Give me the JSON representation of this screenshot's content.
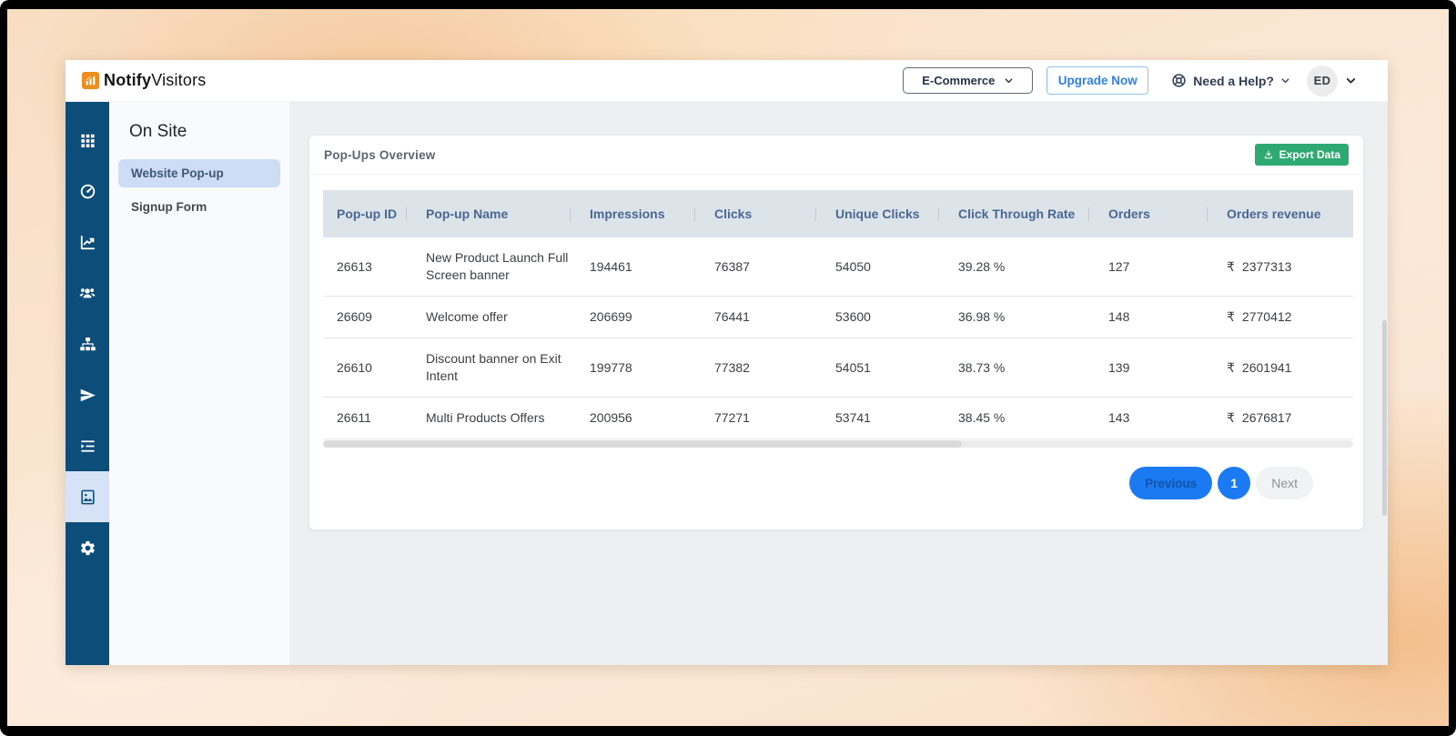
{
  "brand": {
    "name_bold": "Notify",
    "name_light": "Visitors",
    "logo_color": "#ef8e1e"
  },
  "topbar": {
    "workspace_selected": "E-Commerce",
    "upgrade_label": "Upgrade Now",
    "help_label": "Need a Help?",
    "avatar_initials": "ED"
  },
  "rail": {
    "items": [
      {
        "icon": "apps-grid-icon",
        "active": false
      },
      {
        "icon": "dashboard-gauge-icon",
        "active": false
      },
      {
        "icon": "analytics-line-chart-icon",
        "active": false
      },
      {
        "icon": "users-icon",
        "active": false
      },
      {
        "icon": "sitemap-icon",
        "active": false
      },
      {
        "icon": "send-plane-icon",
        "active": false
      },
      {
        "icon": "indent-list-icon",
        "active": false
      },
      {
        "icon": "image-icon",
        "active": true
      },
      {
        "icon": "settings-gear-icon",
        "active": false
      }
    ]
  },
  "subnav": {
    "title": "On Site",
    "items": [
      {
        "label": "Website Pop-up",
        "active": true
      },
      {
        "label": "Signup Form",
        "active": false
      }
    ]
  },
  "card": {
    "title": "Pop-Ups Overview",
    "export_label": "Export Data"
  },
  "table": {
    "columns": [
      "Pop-up ID",
      "Pop-up Name",
      "Impressions",
      "Clicks",
      "Unique Clicks",
      "Click Through Rate",
      "Orders",
      "Orders revenue"
    ],
    "currency": "₹",
    "rows": [
      {
        "id": "26613",
        "name": "New Product Launch Full Screen banner",
        "impressions": "194461",
        "clicks": "76387",
        "unique_clicks": "54050",
        "ctr": "39.28 %",
        "orders": "127",
        "revenue": "2377313"
      },
      {
        "id": "26609",
        "name": "Welcome offer",
        "impressions": "206699",
        "clicks": "76441",
        "unique_clicks": "53600",
        "ctr": "36.98 %",
        "orders": "148",
        "revenue": "2770412"
      },
      {
        "id": "26610",
        "name": "Discount banner on Exit Intent",
        "impressions": "199778",
        "clicks": "77382",
        "unique_clicks": "54051",
        "ctr": "38.73 %",
        "orders": "139",
        "revenue": "2601941"
      },
      {
        "id": "26611",
        "name": "Multi Products Offers",
        "impressions": "200956",
        "clicks": "77271",
        "unique_clicks": "53741",
        "ctr": "38.45 %",
        "orders": "143",
        "revenue": "2676817"
      }
    ]
  },
  "pagination": {
    "previous": "Previous",
    "page": "1",
    "next": "Next"
  },
  "colors": {
    "rail_blue": "#0c4d7a",
    "active_pill": "#cdddf6",
    "accent_blue": "#1b79f1",
    "export_green": "#2ea972",
    "table_header_bg": "#dce4ea",
    "table_header_text": "#4b6791",
    "upgrade_blue": "#2d7ff0",
    "logo_orange": "#ef8e1e"
  }
}
